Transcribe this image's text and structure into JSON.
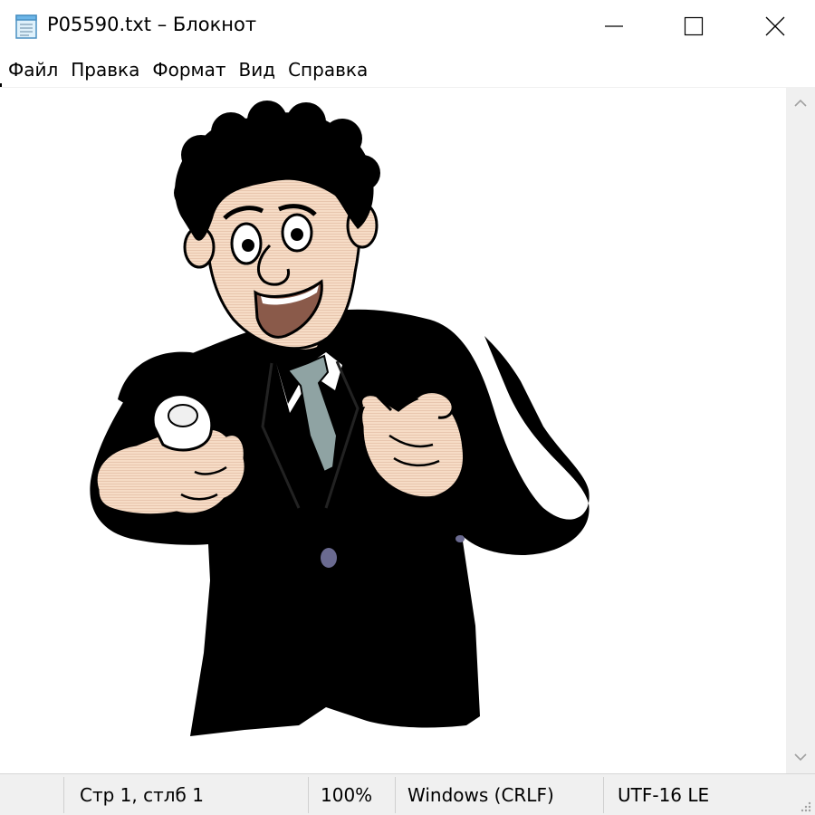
{
  "window": {
    "title": "P05590.txt – Блокнот",
    "icon": "notepad-icon"
  },
  "controls": {
    "minimize_icon": "minimize-icon",
    "maximize_icon": "maximize-icon",
    "close_icon": "close-icon"
  },
  "menu": {
    "items": [
      {
        "label": "Файл"
      },
      {
        "label": "Правка"
      },
      {
        "label": "Формат"
      },
      {
        "label": "Вид"
      },
      {
        "label": "Справка"
      }
    ]
  },
  "editor": {
    "content": "ASCII-art style cartoon of a smiling businessman in a black suit pointing at the viewer",
    "colors": {
      "suit": "#000000",
      "skin": "#f6dcc6",
      "tie": "#8fa3a3",
      "mouth": "#8a5a4a",
      "button": "#6a6a90"
    }
  },
  "scrollbar": {
    "up_icon": "chevron-up-icon",
    "down_icon": "chevron-down-icon"
  },
  "status": {
    "position": "Стр 1, стлб 1",
    "zoom": "100%",
    "line_endings": "Windows (CRLF)",
    "encoding": "UTF-16 LE"
  }
}
